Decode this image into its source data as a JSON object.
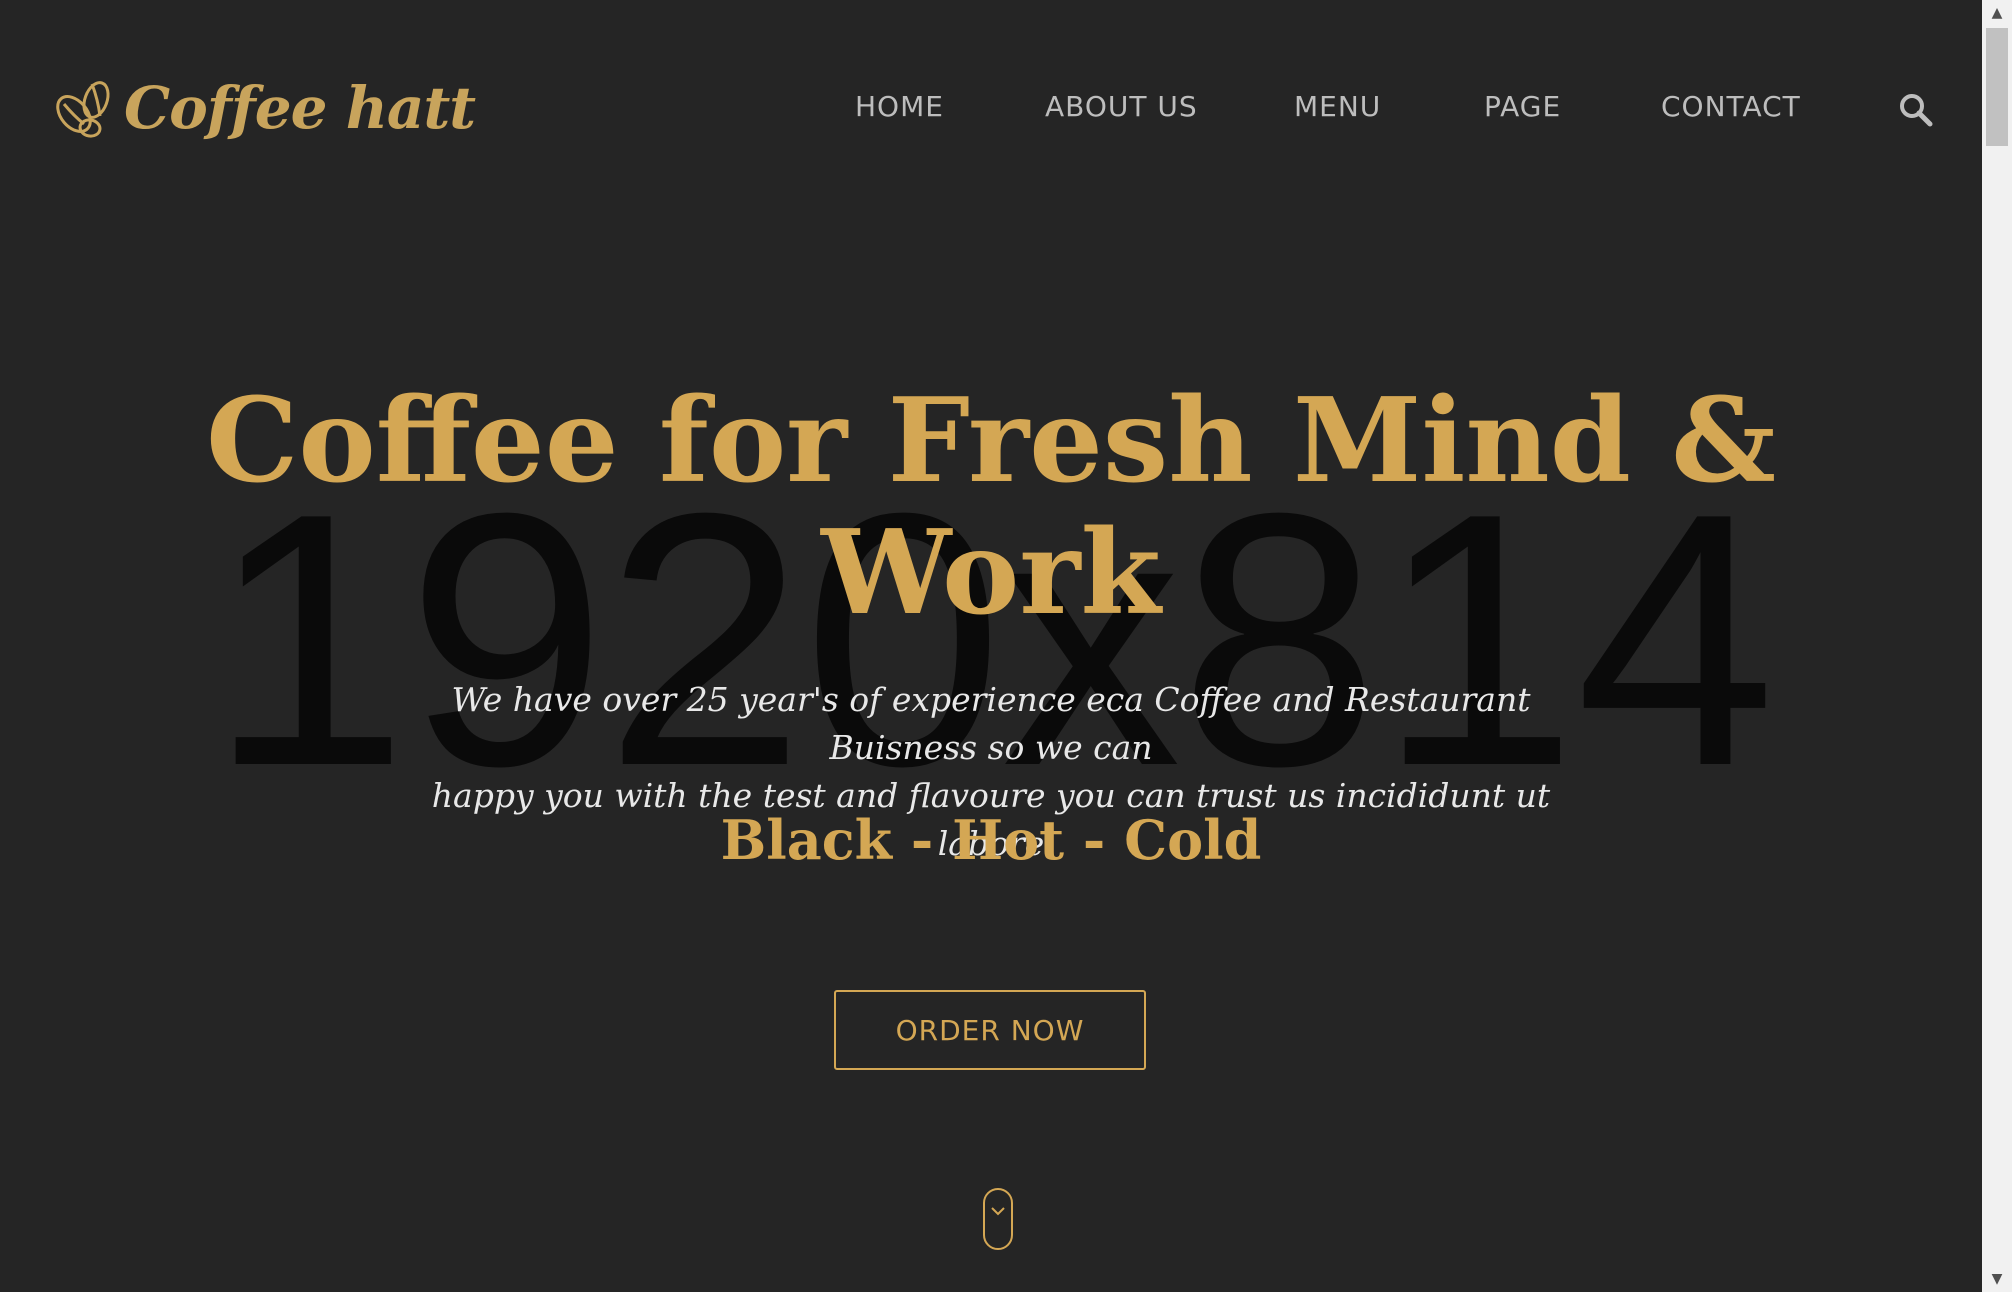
{
  "header": {
    "logo_text": "Coffee hatt",
    "nav": [
      {
        "label": "HOME"
      },
      {
        "label": "ABOUT US"
      },
      {
        "label": "MENU"
      },
      {
        "label": "PAGE"
      },
      {
        "label": "CONTACT"
      }
    ],
    "search_icon": "search-icon"
  },
  "hero": {
    "background_placeholder": "1920x814",
    "title_line1": "Coffee for Fresh Mind &",
    "title_line2": "Work",
    "subtitle_line1": "We have over 25 year's of experience eca Coffee and Restaurant Buisness so we can",
    "subtitle_line2": "happy you with the test and flavoure you can trust us incididunt ut labore",
    "tagline": "Black - Hot - Cold",
    "cta_label": "ORDER NOW",
    "scroll_icon": "mouse-scroll-icon"
  },
  "colors": {
    "background": "#252525",
    "accent": "#d4a754",
    "nav_text": "#bdbdbd",
    "subtitle_text": "#e8e8e8"
  }
}
